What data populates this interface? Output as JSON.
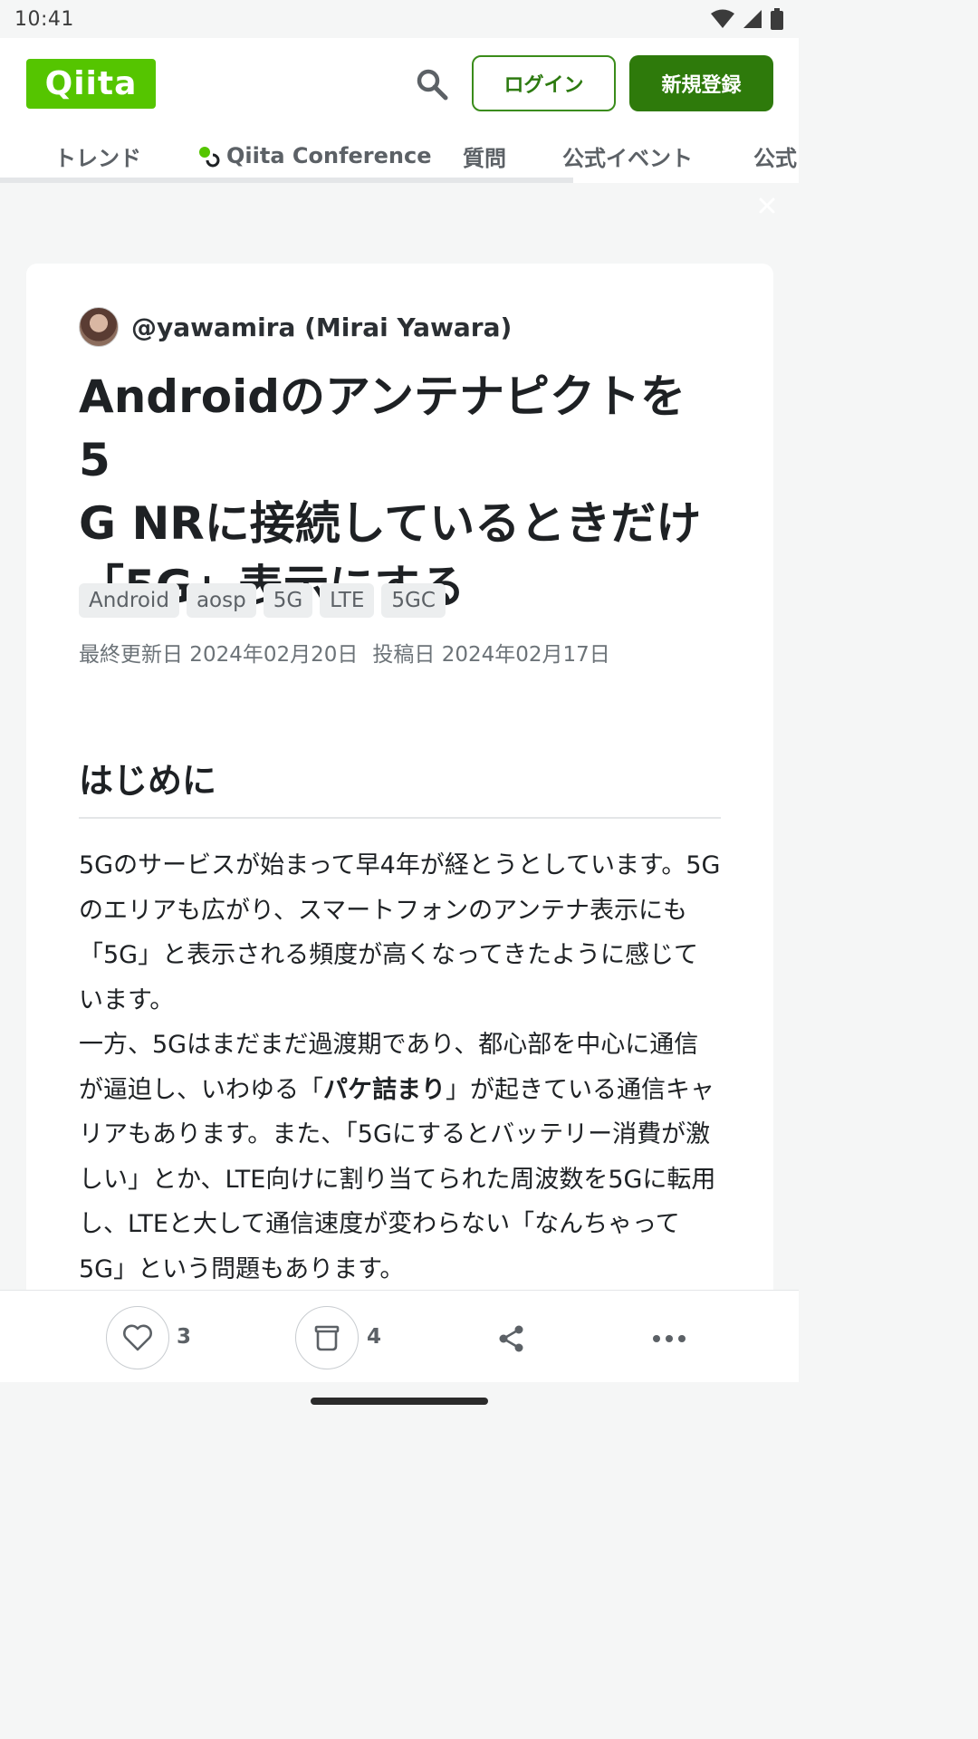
{
  "status_bar": {
    "time": "10:41"
  },
  "header": {
    "logo_text": "Qiita",
    "login_label": "ログイン",
    "signup_label": "新規登録",
    "brand_color": "#55c500"
  },
  "tabs": [
    {
      "label": "トレンド"
    },
    {
      "label": "Qiita Conference"
    },
    {
      "label": "質問"
    },
    {
      "label": "公式イベント"
    },
    {
      "label": "公式"
    }
  ],
  "article": {
    "author": "@yawamira (Mirai Yawara)",
    "title": "AndroidのアンテナピクトをG NRに接続しているときだけ「5G」表示にする",
    "title_lines": [
      "Androidのアンテナピクトを5",
      "G NRに接続しているときだけ",
      "「5G」表示にする"
    ],
    "tags": [
      "Android",
      "aosp",
      "5G",
      "LTE",
      "5GC"
    ],
    "updated": "最終更新日 2024年02月20日",
    "posted": "投稿日 2024年02月17日",
    "section_heading": "はじめに",
    "paragraph1": "5Gのサービスが始まって早4年が経とうとしています。5Gのエリアも広がり、スマートフォンのアンテナ表示にも「5G」と表示される頻度が高くなってきたように感じています。",
    "paragraph2_before": "一方、5Gはまだまだ過渡期であり、都心部を中心に通信が逼迫し、いわゆる「",
    "paragraph2_bold": "パケ詰まり",
    "paragraph2_after": "」が起きている通信キャリアもあります。また、「5Gにするとバッテリー消費が激しい」とか、LTE向けに割り当てられた周波数を5Gに転用し、LTEと大して通信速度が変わらない「なんちゃって5G」という問題もあります。"
  },
  "actions": {
    "likes": "3",
    "stocks": "4"
  }
}
